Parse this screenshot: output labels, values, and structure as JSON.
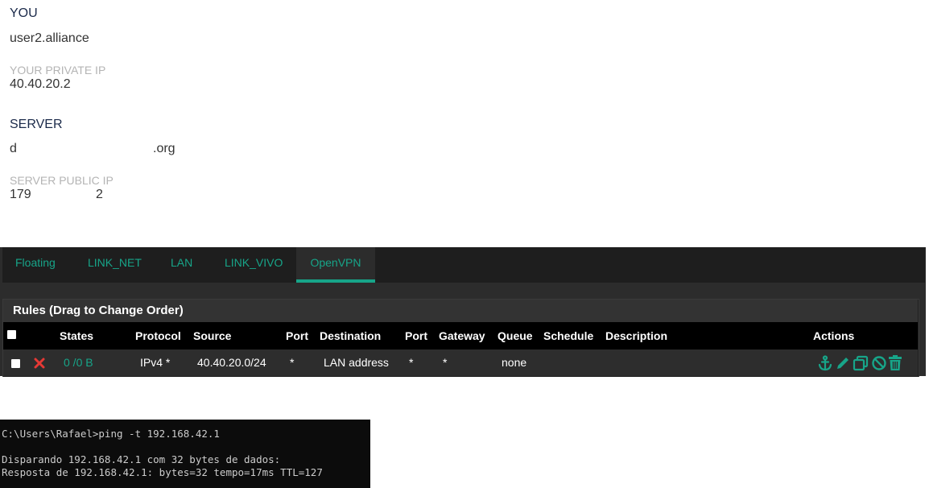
{
  "profile": {
    "you_title": "YOU",
    "username": "user2.alliance",
    "private_ip_label": "YOUR PRIVATE IP",
    "private_ip": "40.40.20.2",
    "server_title": "SERVER",
    "server_name_start": "d",
    "server_name_end": ".org",
    "server_public_ip_label": "SERVER PUBLIC IP",
    "server_ip_start": "179",
    "server_ip_end": "2"
  },
  "firewall": {
    "tabs": [
      "Floating",
      "LINK_NET",
      "LAN",
      "LINK_VIVO",
      "OpenVPN"
    ],
    "active_tab": "OpenVPN",
    "panel_title": "Rules (Drag to Change Order)",
    "columns": [
      "States",
      "Protocol",
      "Source",
      "Port",
      "Destination",
      "Port",
      "Gateway",
      "Queue",
      "Schedule",
      "Description",
      "Actions"
    ],
    "rule": {
      "states": "0 /0 B",
      "protocol": "IPv4 *",
      "source": "40.40.20.0/24",
      "port": "*",
      "destination": "LAN address",
      "dest_port": "*",
      "gateway": "*",
      "queue": "none",
      "schedule": "",
      "description": ""
    },
    "action_icons": [
      "anchor-icon",
      "pencil-icon",
      "copy-icon",
      "disable-icon",
      "trash-icon"
    ],
    "colors": {
      "accent": "#17a589",
      "block": "#e53935"
    }
  },
  "console": {
    "lines": [
      "C:\\Users\\Rafael>ping -t 192.168.42.1",
      "",
      "Disparando 192.168.42.1 com 32 bytes de dados:",
      "Resposta de 192.168.42.1: bytes=32 tempo=17ms TTL=127"
    ]
  }
}
